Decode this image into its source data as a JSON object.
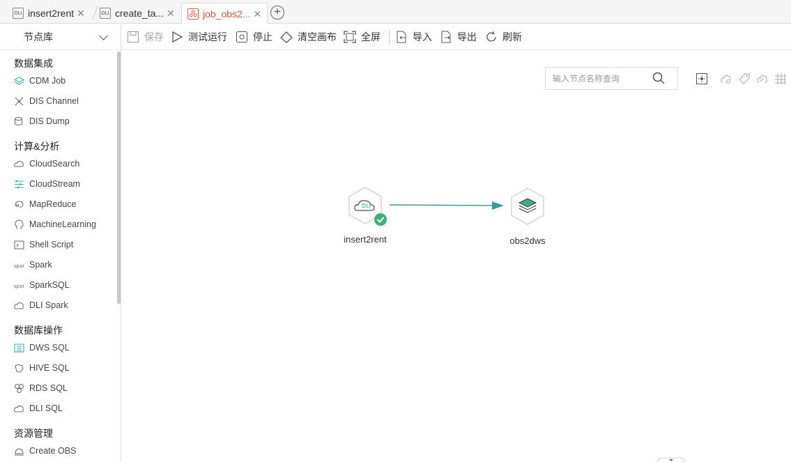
{
  "tabs": [
    {
      "icon_text": "DLI",
      "label": "insert2rent"
    },
    {
      "icon_text": "DLI",
      "label": "create_ta..."
    },
    {
      "icon_text": "",
      "label": "job_obs2..."
    }
  ],
  "toolbar": {
    "save": "保存",
    "test_run": "测试运行",
    "stop": "停止",
    "clear_canvas": "清空画布",
    "fullscreen": "全屏",
    "import": "导入",
    "export": "导出",
    "refresh": "刷新"
  },
  "sidebar": {
    "library_select": "节点库",
    "categories": [
      {
        "title": "数据集成",
        "items": [
          "CDM Job",
          "DIS Channel",
          "DIS Dump"
        ]
      },
      {
        "title": "计算&分析",
        "items": [
          "CloudSearch",
          "CloudStream",
          "MapReduce",
          "MachineLearning",
          "Shell Script",
          "Spark",
          "SparkSQL",
          "DLI Spark"
        ]
      },
      {
        "title": "数据库操作",
        "items": [
          "DWS SQL",
          "HIVE SQL",
          "RDS SQL",
          "DLI SQL"
        ]
      },
      {
        "title": "资源管理",
        "items": [
          "Create OBS"
        ]
      }
    ]
  },
  "canvas": {
    "search_placeholder": "输入节点名称查询",
    "nodes": [
      {
        "name": "insert2rent",
        "badge": "DLI",
        "status": "success"
      },
      {
        "name": "obs2dws"
      }
    ]
  },
  "colors": {
    "accent": "#e0533d",
    "success": "#3bb07a",
    "edge": "#3a9c90"
  }
}
